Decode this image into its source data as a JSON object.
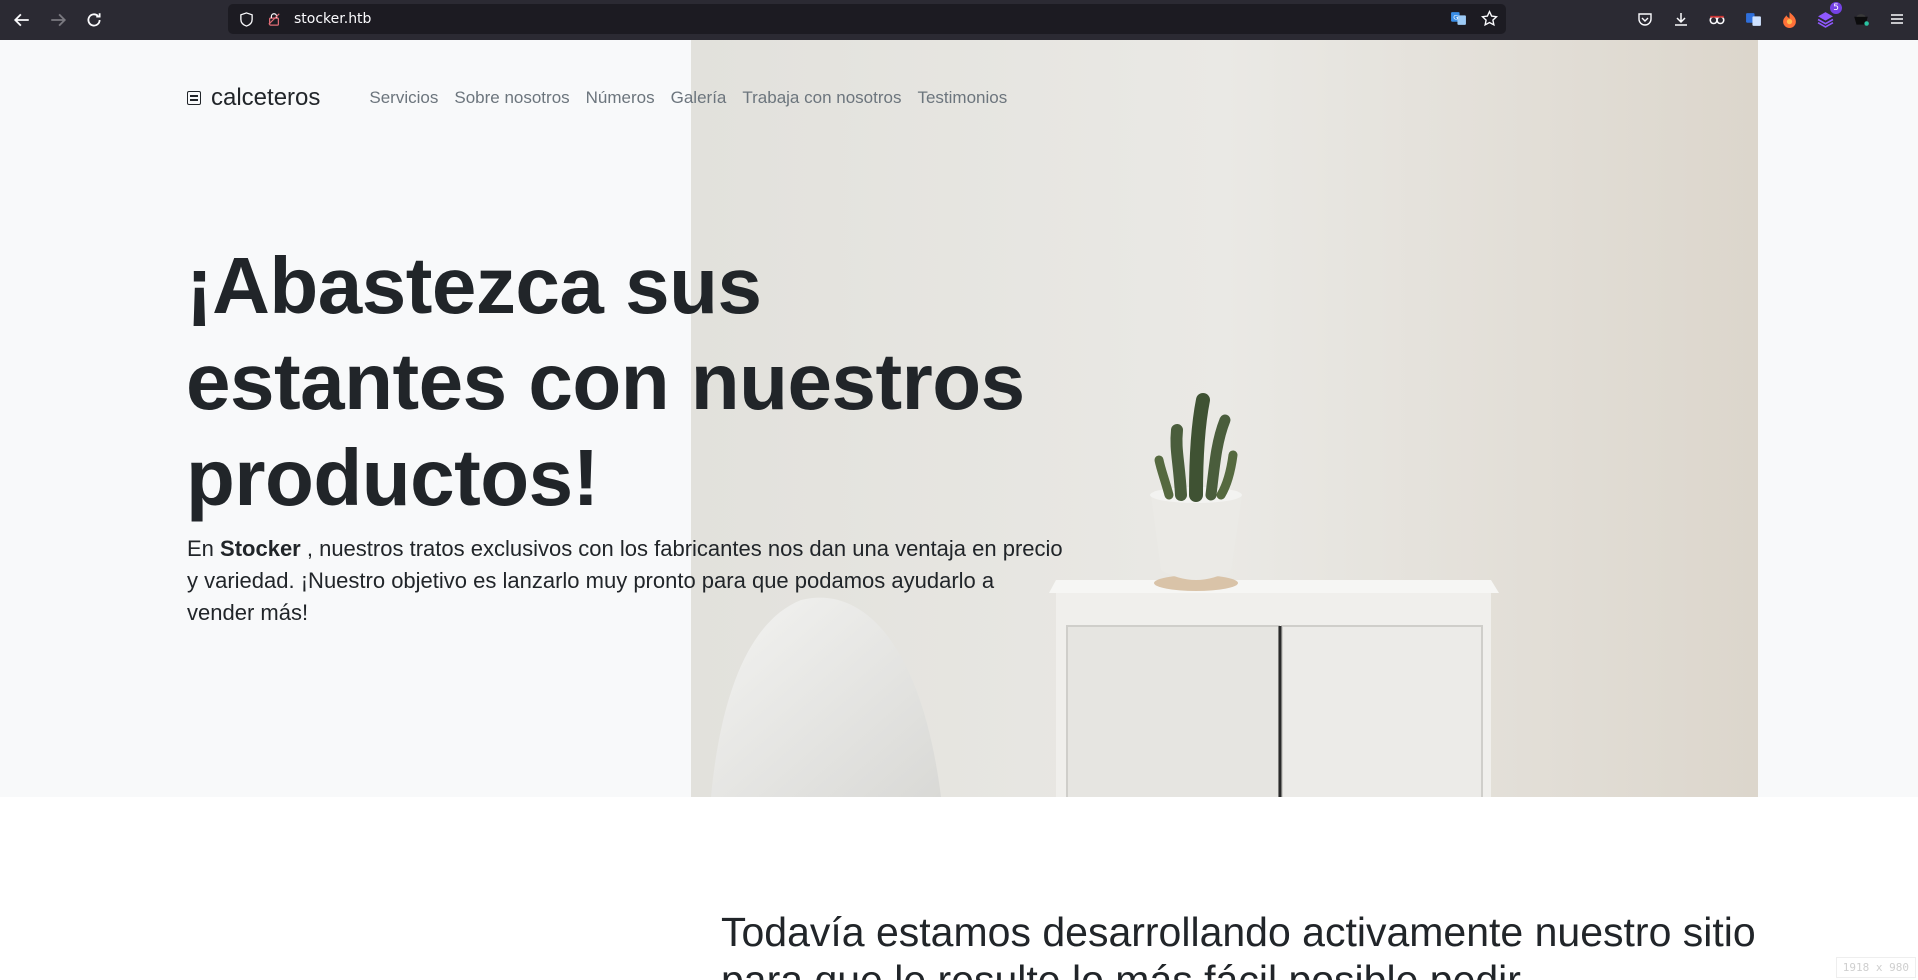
{
  "browser": {
    "url": "stocker.htb",
    "extension_badge": "5",
    "icons": [
      "back-icon",
      "forward-icon",
      "reload-icon",
      "shield-icon",
      "lock-icon",
      "translate-icon",
      "bookmark-star-icon",
      "pocket-icon",
      "download-icon",
      "extension-icon",
      "extension-icon",
      "extension-icon",
      "extension-icon",
      "extension-icon",
      "menu-icon"
    ]
  },
  "nav": {
    "brand": "calceteros",
    "links": [
      "Servicios",
      "Sobre nosotros",
      "Números",
      "Galería",
      "Trabaja con nosotros",
      "Testimonios"
    ]
  },
  "hero": {
    "headline": "¡Abastezca sus estantes con nuestros productos!",
    "lead_prefix": "En ",
    "lead_brand": "Stocker",
    "lead_rest": " , nuestros tratos exclusivos con los fabricantes nos dan una ventaja en precio y variedad. ¡Nuestro objetivo es lanzarlo muy pronto para que podamos ayudarlo a vender más!"
  },
  "section2": {
    "heading": "Todavía estamos desarrollando activamente nuestro sitio para que le resulte lo más fácil posible pedir"
  },
  "size_tag": "1918 x 980"
}
